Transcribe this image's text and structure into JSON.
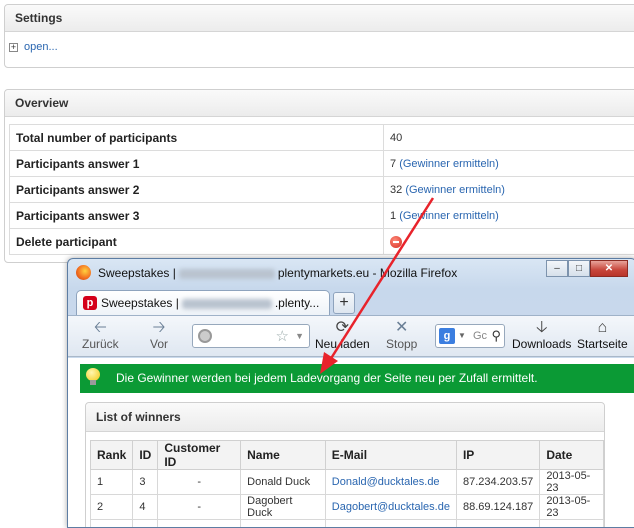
{
  "settings": {
    "title": "Settings",
    "open_label": "open..."
  },
  "overview": {
    "title": "Overview",
    "rows": [
      {
        "label": "Total number of participants",
        "value": "40",
        "link": ""
      },
      {
        "label": "Participants answer 1",
        "value": "7",
        "link": "(Gewinner ermitteln)"
      },
      {
        "label": "Participants answer 2",
        "value": "32",
        "link": "(Gewinner ermitteln)"
      },
      {
        "label": "Participants answer 3",
        "value": "1",
        "link": "(Gewinner ermitteln)"
      },
      {
        "label": "Delete participant",
        "value": "",
        "link": ""
      }
    ]
  },
  "browser": {
    "title_prefix": "Sweepstakes |",
    "title_suffix": "plentymarkets.eu - Mozilla Firefox",
    "tab_prefix": "Sweepstakes |",
    "tab_suffix": ".plenty...",
    "new_tab": "+",
    "toolbar": {
      "back": "Zurück",
      "forward": "Vor",
      "reload": "Neu laden",
      "stop": "Stopp",
      "downloads": "Downloads",
      "home": "Startseite"
    },
    "search_placeholder": "Gc",
    "search_engine": "g"
  },
  "notice": "Die Gewinner werden bei jedem Ladevorgang der Seite neu per Zufall ermittelt.",
  "winners": {
    "title": "List of winners",
    "columns": [
      "Rank",
      "ID",
      "Customer ID",
      "Name",
      "E-Mail",
      "IP",
      "Date"
    ],
    "rows": [
      {
        "rank": "1",
        "id": "3",
        "customer_id": "-",
        "name": "Donald Duck",
        "email": "Donald@ducktales.de",
        "ip": "87.234.203.57",
        "date": "2013-05-23"
      },
      {
        "rank": "2",
        "id": "4",
        "customer_id": "-",
        "name": "Dagobert Duck",
        "email": "Dagobert@ducktales.de",
        "ip": "88.69.124.187",
        "date": "2013-05-23"
      }
    ]
  },
  "colors": {
    "notice_bg": "#0b9a35",
    "link": "#2a66b0",
    "arrow": "#e8232b"
  }
}
